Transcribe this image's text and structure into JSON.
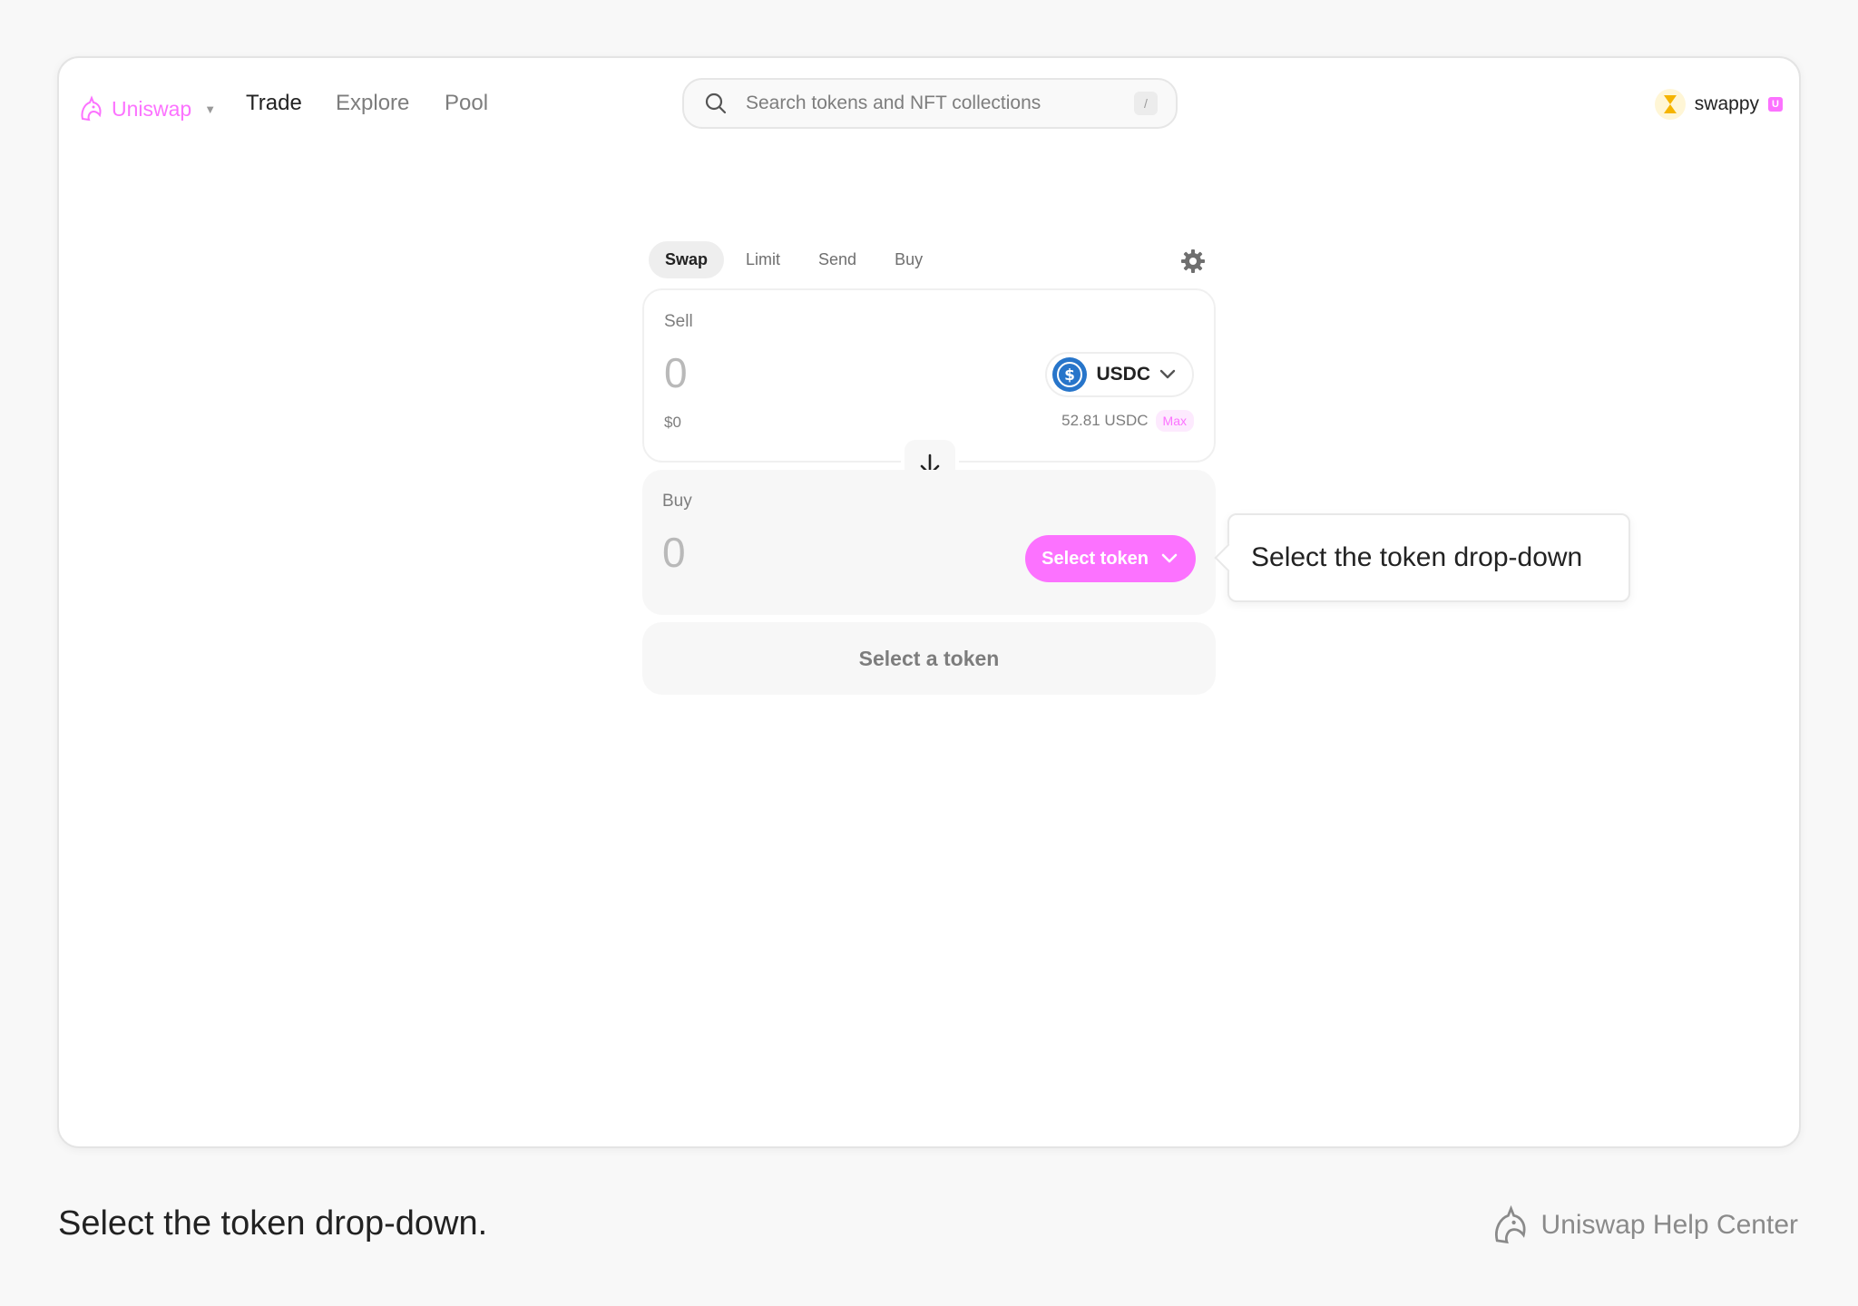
{
  "app": {
    "brand": "Uniswap",
    "nav": [
      {
        "label": "Trade",
        "active": true
      },
      {
        "label": "Explore",
        "active": false
      },
      {
        "label": "Pool",
        "active": false
      }
    ],
    "search": {
      "placeholder": "Search tokens and NFT collections",
      "shortcut": "/"
    },
    "account": {
      "name": "swappy"
    }
  },
  "swap": {
    "tabs": [
      {
        "label": "Swap",
        "active": true
      },
      {
        "label": "Limit",
        "active": false
      },
      {
        "label": "Send",
        "active": false
      },
      {
        "label": "Buy",
        "active": false
      }
    ],
    "sell": {
      "label": "Sell",
      "amount": "0",
      "usd": "$0",
      "token": "USDC",
      "balance": "52.81 USDC",
      "max_label": "Max"
    },
    "buy": {
      "label": "Buy",
      "amount": "0",
      "select_label": "Select token"
    },
    "cta": "Select a token"
  },
  "tooltip": "Select the token drop-down",
  "caption": "Select the token drop-down.",
  "footer_brand": "Uniswap Help Center",
  "colors": {
    "accent": "#fc72ff",
    "usdc": "#2775ca"
  }
}
